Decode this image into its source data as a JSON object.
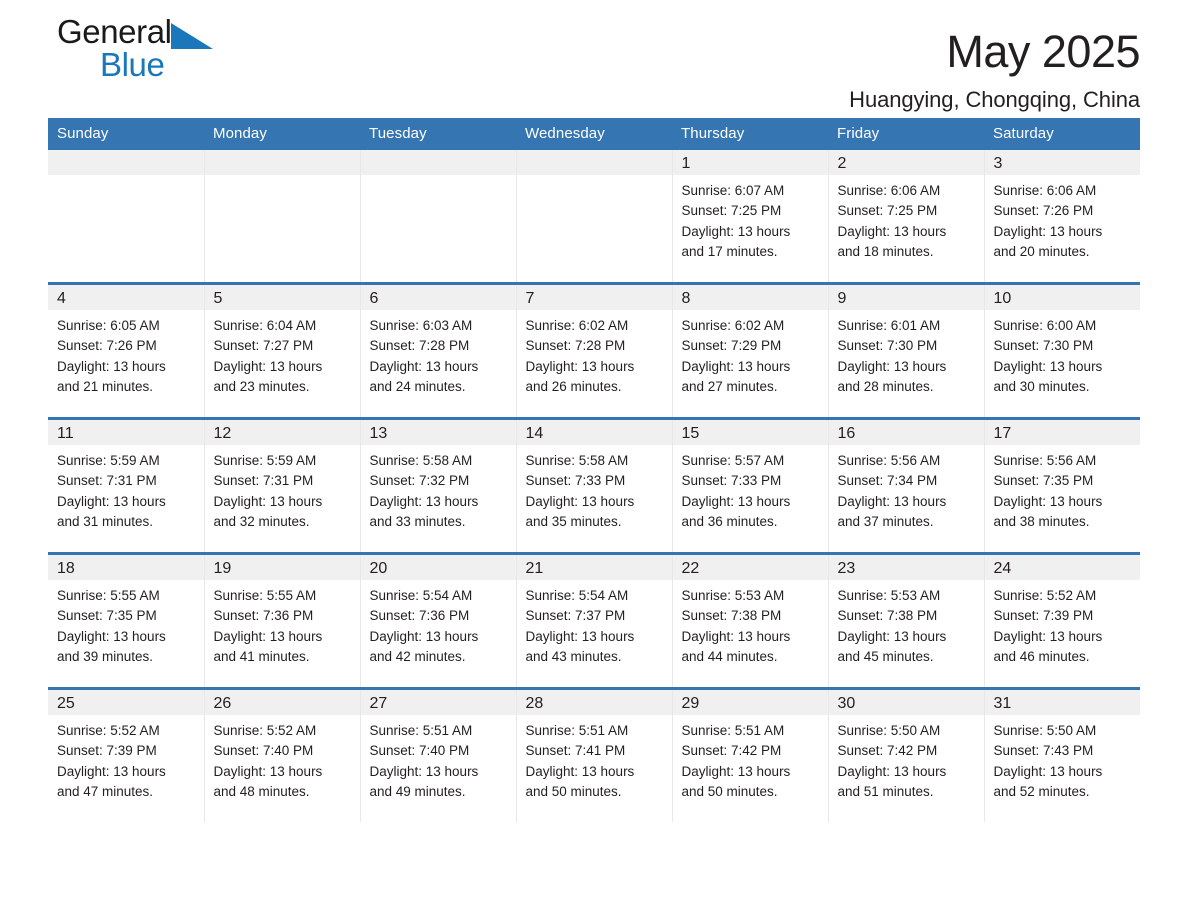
{
  "brand": {
    "name_part1": "General",
    "name_part2": "Blue",
    "logo_icon": "triangle-flag-icon",
    "accent_color": "#1b77bb"
  },
  "header": {
    "title": "May 2025",
    "location": "Huangying, Chongqing, China"
  },
  "theme": {
    "header_blue": "#3575b2",
    "daynum_band": "#f0f0f0",
    "text": "#231f20"
  },
  "weekday_headers": [
    "Sunday",
    "Monday",
    "Tuesday",
    "Wednesday",
    "Thursday",
    "Friday",
    "Saturday"
  ],
  "weeks": [
    [
      {
        "day": "",
        "lines": []
      },
      {
        "day": "",
        "lines": []
      },
      {
        "day": "",
        "lines": []
      },
      {
        "day": "",
        "lines": []
      },
      {
        "day": "1",
        "lines": [
          "Sunrise: 6:07 AM",
          "Sunset: 7:25 PM",
          "Daylight: 13 hours",
          "and 17 minutes."
        ]
      },
      {
        "day": "2",
        "lines": [
          "Sunrise: 6:06 AM",
          "Sunset: 7:25 PM",
          "Daylight: 13 hours",
          "and 18 minutes."
        ]
      },
      {
        "day": "3",
        "lines": [
          "Sunrise: 6:06 AM",
          "Sunset: 7:26 PM",
          "Daylight: 13 hours",
          "and 20 minutes."
        ]
      }
    ],
    [
      {
        "day": "4",
        "lines": [
          "Sunrise: 6:05 AM",
          "Sunset: 7:26 PM",
          "Daylight: 13 hours",
          "and 21 minutes."
        ]
      },
      {
        "day": "5",
        "lines": [
          "Sunrise: 6:04 AM",
          "Sunset: 7:27 PM",
          "Daylight: 13 hours",
          "and 23 minutes."
        ]
      },
      {
        "day": "6",
        "lines": [
          "Sunrise: 6:03 AM",
          "Sunset: 7:28 PM",
          "Daylight: 13 hours",
          "and 24 minutes."
        ]
      },
      {
        "day": "7",
        "lines": [
          "Sunrise: 6:02 AM",
          "Sunset: 7:28 PM",
          "Daylight: 13 hours",
          "and 26 minutes."
        ]
      },
      {
        "day": "8",
        "lines": [
          "Sunrise: 6:02 AM",
          "Sunset: 7:29 PM",
          "Daylight: 13 hours",
          "and 27 minutes."
        ]
      },
      {
        "day": "9",
        "lines": [
          "Sunrise: 6:01 AM",
          "Sunset: 7:30 PM",
          "Daylight: 13 hours",
          "and 28 minutes."
        ]
      },
      {
        "day": "10",
        "lines": [
          "Sunrise: 6:00 AM",
          "Sunset: 7:30 PM",
          "Daylight: 13 hours",
          "and 30 minutes."
        ]
      }
    ],
    [
      {
        "day": "11",
        "lines": [
          "Sunrise: 5:59 AM",
          "Sunset: 7:31 PM",
          "Daylight: 13 hours",
          "and 31 minutes."
        ]
      },
      {
        "day": "12",
        "lines": [
          "Sunrise: 5:59 AM",
          "Sunset: 7:31 PM",
          "Daylight: 13 hours",
          "and 32 minutes."
        ]
      },
      {
        "day": "13",
        "lines": [
          "Sunrise: 5:58 AM",
          "Sunset: 7:32 PM",
          "Daylight: 13 hours",
          "and 33 minutes."
        ]
      },
      {
        "day": "14",
        "lines": [
          "Sunrise: 5:58 AM",
          "Sunset: 7:33 PM",
          "Daylight: 13 hours",
          "and 35 minutes."
        ]
      },
      {
        "day": "15",
        "lines": [
          "Sunrise: 5:57 AM",
          "Sunset: 7:33 PM",
          "Daylight: 13 hours",
          "and 36 minutes."
        ]
      },
      {
        "day": "16",
        "lines": [
          "Sunrise: 5:56 AM",
          "Sunset: 7:34 PM",
          "Daylight: 13 hours",
          "and 37 minutes."
        ]
      },
      {
        "day": "17",
        "lines": [
          "Sunrise: 5:56 AM",
          "Sunset: 7:35 PM",
          "Daylight: 13 hours",
          "and 38 minutes."
        ]
      }
    ],
    [
      {
        "day": "18",
        "lines": [
          "Sunrise: 5:55 AM",
          "Sunset: 7:35 PM",
          "Daylight: 13 hours",
          "and 39 minutes."
        ]
      },
      {
        "day": "19",
        "lines": [
          "Sunrise: 5:55 AM",
          "Sunset: 7:36 PM",
          "Daylight: 13 hours",
          "and 41 minutes."
        ]
      },
      {
        "day": "20",
        "lines": [
          "Sunrise: 5:54 AM",
          "Sunset: 7:36 PM",
          "Daylight: 13 hours",
          "and 42 minutes."
        ]
      },
      {
        "day": "21",
        "lines": [
          "Sunrise: 5:54 AM",
          "Sunset: 7:37 PM",
          "Daylight: 13 hours",
          "and 43 minutes."
        ]
      },
      {
        "day": "22",
        "lines": [
          "Sunrise: 5:53 AM",
          "Sunset: 7:38 PM",
          "Daylight: 13 hours",
          "and 44 minutes."
        ]
      },
      {
        "day": "23",
        "lines": [
          "Sunrise: 5:53 AM",
          "Sunset: 7:38 PM",
          "Daylight: 13 hours",
          "and 45 minutes."
        ]
      },
      {
        "day": "24",
        "lines": [
          "Sunrise: 5:52 AM",
          "Sunset: 7:39 PM",
          "Daylight: 13 hours",
          "and 46 minutes."
        ]
      }
    ],
    [
      {
        "day": "25",
        "lines": [
          "Sunrise: 5:52 AM",
          "Sunset: 7:39 PM",
          "Daylight: 13 hours",
          "and 47 minutes."
        ]
      },
      {
        "day": "26",
        "lines": [
          "Sunrise: 5:52 AM",
          "Sunset: 7:40 PM",
          "Daylight: 13 hours",
          "and 48 minutes."
        ]
      },
      {
        "day": "27",
        "lines": [
          "Sunrise: 5:51 AM",
          "Sunset: 7:40 PM",
          "Daylight: 13 hours",
          "and 49 minutes."
        ]
      },
      {
        "day": "28",
        "lines": [
          "Sunrise: 5:51 AM",
          "Sunset: 7:41 PM",
          "Daylight: 13 hours",
          "and 50 minutes."
        ]
      },
      {
        "day": "29",
        "lines": [
          "Sunrise: 5:51 AM",
          "Sunset: 7:42 PM",
          "Daylight: 13 hours",
          "and 50 minutes."
        ]
      },
      {
        "day": "30",
        "lines": [
          "Sunrise: 5:50 AM",
          "Sunset: 7:42 PM",
          "Daylight: 13 hours",
          "and 51 minutes."
        ]
      },
      {
        "day": "31",
        "lines": [
          "Sunrise: 5:50 AM",
          "Sunset: 7:43 PM",
          "Daylight: 13 hours",
          "and 52 minutes."
        ]
      }
    ]
  ]
}
